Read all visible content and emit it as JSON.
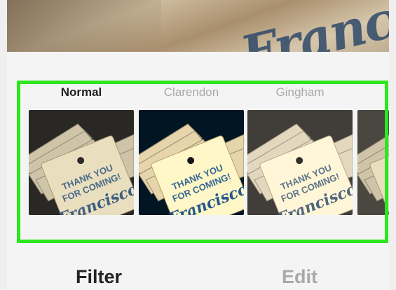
{
  "preview": {
    "image_icon": "photo-preview",
    "script_text": "Francisco"
  },
  "filters": [
    {
      "name": "Normal",
      "state": "active"
    },
    {
      "name": "Clarendon",
      "state": "inactive"
    },
    {
      "name": "Gingham",
      "state": "inactive"
    }
  ],
  "thumbnail_text": {
    "line1": "THANK YOU",
    "line2": "FOR COMING!",
    "script": "Francisco"
  },
  "tabs": {
    "filter_label": "Filter",
    "edit_label": "Edit"
  },
  "colors": {
    "highlight": "#2de61e",
    "active_text": "#222222",
    "inactive_text": "#a9a9a9"
  }
}
